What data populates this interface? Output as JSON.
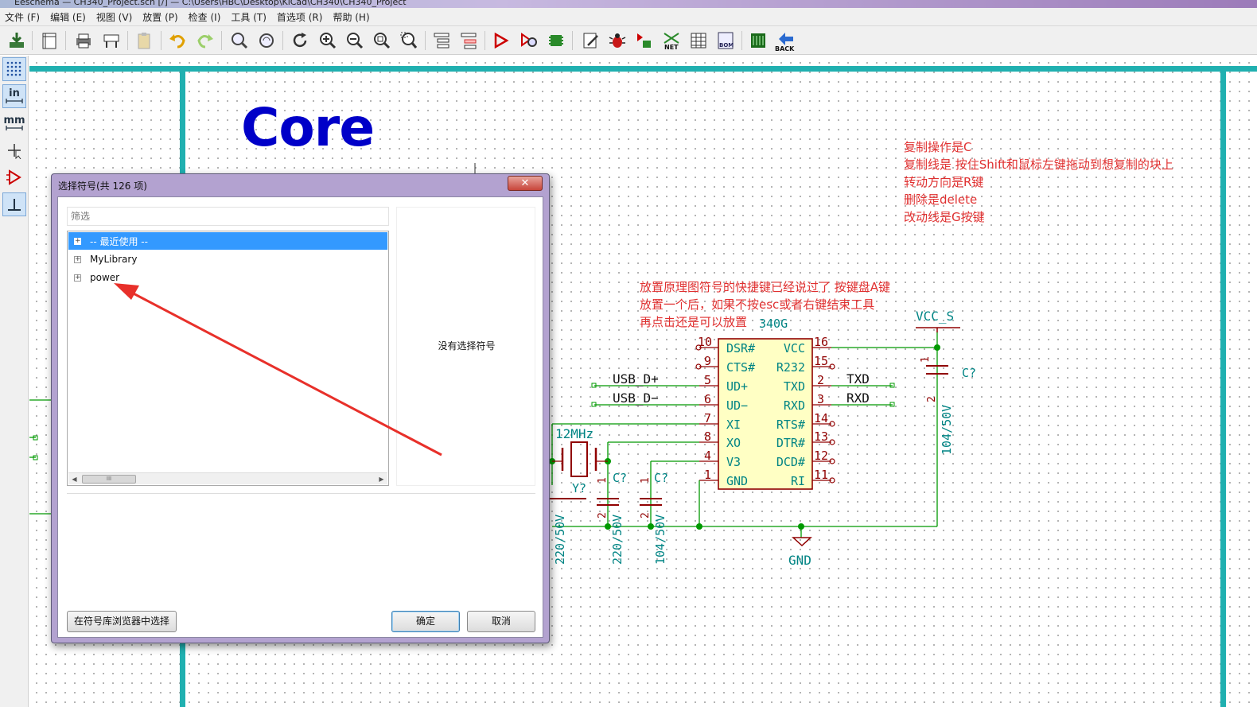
{
  "window": {
    "title": "Eeschema — CH340_Project.sch [/] — C:\\Users\\HBC\\Desktop\\KiCad\\CH340\\CH340_Project"
  },
  "menu": [
    "文件 (F)",
    "编辑 (E)",
    "视图 (V)",
    "放置 (P)",
    "检查 (I)",
    "工具 (T)",
    "首选项 (R)",
    "帮助 (H)"
  ],
  "toolbar_icons": [
    "save-icon",
    "page-settings-icon",
    "print-icon",
    "plot-icon",
    "paste-icon",
    "undo-icon",
    "redo-icon",
    "find-icon",
    "find-replace-icon",
    "refresh-icon",
    "zoom-in-icon",
    "zoom-out-icon",
    "zoom-fit-icon",
    "zoom-selection-icon",
    "hierarchy-icon",
    "leave-sheet-icon",
    "library-editor-icon",
    "library-browser-icon",
    "footprint-editor-icon",
    "annotate-icon",
    "erc-icon",
    "assign-footprints-icon",
    "netlist-icon",
    "fields-table-icon",
    "bom-icon",
    "pcbnew-icon",
    "back-annotate-icon"
  ],
  "toolbar_labels": {
    "netlist": "NET",
    "bom": "BOM",
    "back": "BACK"
  },
  "left_toolbar": {
    "units_in": "in",
    "units_mm": "mm"
  },
  "schematic": {
    "title": "Core",
    "notes_top": [
      "复制操作是C",
      "复制线是 按住Shift和鼠标左键拖动到想复制的块上",
      "转动方向是R键",
      "删除是delete",
      "改动线是G按键"
    ],
    "notes_mid": [
      "放置原理图符号的快捷键已经说过了 按键盘A键",
      "放置一个后，如果不按esc或者右键结束工具",
      "再点击还是可以放置"
    ],
    "ic_ref": "340G",
    "ic_pins_left": [
      {
        "num": "10",
        "name": "DSR#"
      },
      {
        "num": "9",
        "name": "CTS#"
      },
      {
        "num": "5",
        "name": "UD+"
      },
      {
        "num": "6",
        "name": "UD−"
      },
      {
        "num": "7",
        "name": "XI"
      },
      {
        "num": "8",
        "name": "XO"
      },
      {
        "num": "4",
        "name": "V3"
      },
      {
        "num": "1",
        "name": "GND"
      }
    ],
    "ic_pins_right": [
      {
        "num": "16",
        "name": "VCC"
      },
      {
        "num": "15",
        "name": "R232"
      },
      {
        "num": "2",
        "name": "TXD"
      },
      {
        "num": "3",
        "name": "RXD"
      },
      {
        "num": "14",
        "name": "RTS#"
      },
      {
        "num": "13",
        "name": "DTR#"
      },
      {
        "num": "12",
        "name": "DCD#"
      },
      {
        "num": "11",
        "name": "RI"
      }
    ],
    "net_labels": {
      "usb_dp": "USB_D+",
      "usb_dm": "USB_D−",
      "txd": "TXD",
      "rxd": "RXD",
      "vcc": "VCC_S",
      "gnd": "GND"
    },
    "crystal": {
      "value": "12MHz",
      "ref": "Y?"
    },
    "caps": [
      {
        "ref": "C?",
        "value": "104/50V",
        "pin1": "1",
        "pin2": "2"
      },
      {
        "ref": "C?",
        "value": "220/50V",
        "pin1": "1",
        "pin2": "2"
      },
      {
        "ref": "C?",
        "value": "104/50V",
        "pin1": "1",
        "pin2": "2"
      },
      {
        "ref": "",
        "value": "220/50V"
      }
    ]
  },
  "dialog": {
    "title": "选择符号(共 126 项)",
    "close": "✕",
    "filter_placeholder": "筛选",
    "tree": [
      {
        "label": "-- 最近使用 --",
        "selected": true
      },
      {
        "label": "MyLibrary",
        "selected": false
      },
      {
        "label": "power",
        "selected": false
      }
    ],
    "scroll_thumb": "III",
    "preview_empty": "没有选择符号",
    "browse_button": "在符号库浏览器中选择",
    "ok_button": "确定",
    "cancel_button": "取消"
  },
  "colors": {
    "accent_teal": "#20b0b0",
    "wire_green": "#009900",
    "component_red": "#900000",
    "text_teal": "#008484",
    "note_red": "#e03030",
    "title_blue": "#0000c8",
    "arrow_red": "#e8302a"
  }
}
